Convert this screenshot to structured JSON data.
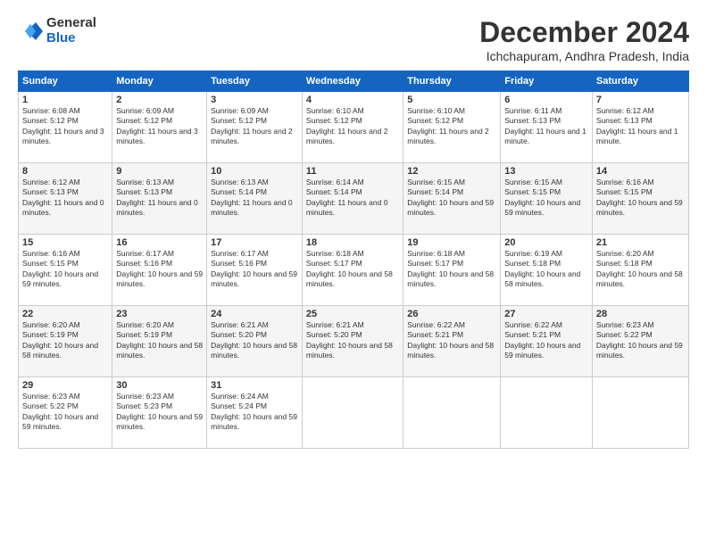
{
  "logo": {
    "general": "General",
    "blue": "Blue"
  },
  "title": "December 2024",
  "subtitle": "Ichchapuram, Andhra Pradesh, India",
  "days_header": [
    "Sunday",
    "Monday",
    "Tuesday",
    "Wednesday",
    "Thursday",
    "Friday",
    "Saturday"
  ],
  "weeks": [
    [
      {
        "day": "1",
        "sunrise": "6:08 AM",
        "sunset": "5:12 PM",
        "daylight": "11 hours and 3 minutes."
      },
      {
        "day": "2",
        "sunrise": "6:09 AM",
        "sunset": "5:12 PM",
        "daylight": "11 hours and 3 minutes."
      },
      {
        "day": "3",
        "sunrise": "6:09 AM",
        "sunset": "5:12 PM",
        "daylight": "11 hours and 2 minutes."
      },
      {
        "day": "4",
        "sunrise": "6:10 AM",
        "sunset": "5:12 PM",
        "daylight": "11 hours and 2 minutes."
      },
      {
        "day": "5",
        "sunrise": "6:10 AM",
        "sunset": "5:12 PM",
        "daylight": "11 hours and 2 minutes."
      },
      {
        "day": "6",
        "sunrise": "6:11 AM",
        "sunset": "5:13 PM",
        "daylight": "11 hours and 1 minute."
      },
      {
        "day": "7",
        "sunrise": "6:12 AM",
        "sunset": "5:13 PM",
        "daylight": "11 hours and 1 minute."
      }
    ],
    [
      {
        "day": "8",
        "sunrise": "6:12 AM",
        "sunset": "5:13 PM",
        "daylight": "11 hours and 0 minutes."
      },
      {
        "day": "9",
        "sunrise": "6:13 AM",
        "sunset": "5:13 PM",
        "daylight": "11 hours and 0 minutes."
      },
      {
        "day": "10",
        "sunrise": "6:13 AM",
        "sunset": "5:14 PM",
        "daylight": "11 hours and 0 minutes."
      },
      {
        "day": "11",
        "sunrise": "6:14 AM",
        "sunset": "5:14 PM",
        "daylight": "11 hours and 0 minutes."
      },
      {
        "day": "12",
        "sunrise": "6:15 AM",
        "sunset": "5:14 PM",
        "daylight": "10 hours and 59 minutes."
      },
      {
        "day": "13",
        "sunrise": "6:15 AM",
        "sunset": "5:15 PM",
        "daylight": "10 hours and 59 minutes."
      },
      {
        "day": "14",
        "sunrise": "6:16 AM",
        "sunset": "5:15 PM",
        "daylight": "10 hours and 59 minutes."
      }
    ],
    [
      {
        "day": "15",
        "sunrise": "6:16 AM",
        "sunset": "5:15 PM",
        "daylight": "10 hours and 59 minutes."
      },
      {
        "day": "16",
        "sunrise": "6:17 AM",
        "sunset": "5:16 PM",
        "daylight": "10 hours and 59 minutes."
      },
      {
        "day": "17",
        "sunrise": "6:17 AM",
        "sunset": "5:16 PM",
        "daylight": "10 hours and 59 minutes."
      },
      {
        "day": "18",
        "sunrise": "6:18 AM",
        "sunset": "5:17 PM",
        "daylight": "10 hours and 58 minutes."
      },
      {
        "day": "19",
        "sunrise": "6:18 AM",
        "sunset": "5:17 PM",
        "daylight": "10 hours and 58 minutes."
      },
      {
        "day": "20",
        "sunrise": "6:19 AM",
        "sunset": "5:18 PM",
        "daylight": "10 hours and 58 minutes."
      },
      {
        "day": "21",
        "sunrise": "6:20 AM",
        "sunset": "5:18 PM",
        "daylight": "10 hours and 58 minutes."
      }
    ],
    [
      {
        "day": "22",
        "sunrise": "6:20 AM",
        "sunset": "5:19 PM",
        "daylight": "10 hours and 58 minutes."
      },
      {
        "day": "23",
        "sunrise": "6:20 AM",
        "sunset": "5:19 PM",
        "daylight": "10 hours and 58 minutes."
      },
      {
        "day": "24",
        "sunrise": "6:21 AM",
        "sunset": "5:20 PM",
        "daylight": "10 hours and 58 minutes."
      },
      {
        "day": "25",
        "sunrise": "6:21 AM",
        "sunset": "5:20 PM",
        "daylight": "10 hours and 58 minutes."
      },
      {
        "day": "26",
        "sunrise": "6:22 AM",
        "sunset": "5:21 PM",
        "daylight": "10 hours and 58 minutes."
      },
      {
        "day": "27",
        "sunrise": "6:22 AM",
        "sunset": "5:21 PM",
        "daylight": "10 hours and 59 minutes."
      },
      {
        "day": "28",
        "sunrise": "6:23 AM",
        "sunset": "5:22 PM",
        "daylight": "10 hours and 59 minutes."
      }
    ],
    [
      {
        "day": "29",
        "sunrise": "6:23 AM",
        "sunset": "5:22 PM",
        "daylight": "10 hours and 59 minutes."
      },
      {
        "day": "30",
        "sunrise": "6:23 AM",
        "sunset": "5:23 PM",
        "daylight": "10 hours and 59 minutes."
      },
      {
        "day": "31",
        "sunrise": "6:24 AM",
        "sunset": "5:24 PM",
        "daylight": "10 hours and 59 minutes."
      },
      null,
      null,
      null,
      null
    ]
  ]
}
